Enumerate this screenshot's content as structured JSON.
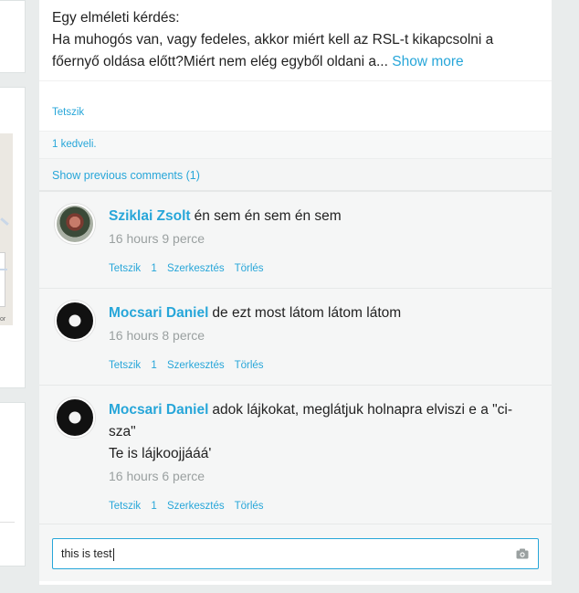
{
  "post": {
    "line1": "Egy elméleti kérdés:",
    "line2": "Ha muhogós van, vagy fedeles, akkor miért kell az RSL-t kikapcsolni a",
    "line3": "főernyő oldása előtt?Miért nem elég egyből oldani a...",
    "show_more": "Show more",
    "like_label": "Tetszik",
    "likes_count": "1 kedveli.",
    "previous_comments": "Show previous comments (1)"
  },
  "comments": [
    {
      "author": "Sziklai Zsolt",
      "text": "én sem én sem én sem",
      "time": "16 hours 9 perce",
      "actions": {
        "like": "Tetszik",
        "count": "1",
        "edit": "Szerkesztés",
        "delete": "Törlés"
      }
    },
    {
      "author": "Mocsari Daniel",
      "text": "de ezt most látom látom látom",
      "time": "16 hours 8 perce",
      "actions": {
        "like": "Tetszik",
        "count": "1",
        "edit": "Szerkesztés",
        "delete": "Törlés"
      }
    },
    {
      "author": "Mocsari Daniel",
      "text_line1": "adok lájkokat, meglátjuk holnapra elviszi e a \"ci-",
      "text_line2": "sza\"",
      "text_line3": "Te is lájkoojjááá'",
      "time": "16 hours 6 perce",
      "actions": {
        "like": "Tetszik",
        "count": "1",
        "edit": "Szerkesztés",
        "delete": "Törlés"
      }
    }
  ],
  "input": {
    "value": "this is test"
  },
  "left": {
    "map_credit": "or"
  },
  "colors": {
    "accent": "#27a6d9",
    "muted": "#9aa0a0",
    "background": "#e9ecec"
  },
  "icons": {
    "camera": "camera-icon"
  }
}
